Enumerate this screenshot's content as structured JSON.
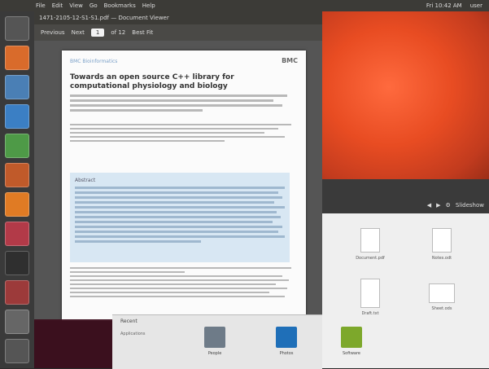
{
  "topbar": {
    "menu": [
      "File",
      "Edit",
      "View",
      "Go",
      "Bookmarks",
      "Help"
    ],
    "status": [
      "Fri 10:42 AM",
      "user"
    ]
  },
  "viewer": {
    "title": "1471-2105-12-S1-S1.pdf — Document Viewer",
    "toolbar": {
      "prev": "Previous",
      "next": "Next",
      "page_value": "1",
      "page_of": "of 12",
      "zoom": "Best Fit"
    }
  },
  "page": {
    "journal": "BMC Bioinformatics",
    "logo": "BMC",
    "title": "Towards an open source C++ library for computational physiology and biology",
    "abstract_heading": "Abstract"
  },
  "photo_viewer": {
    "controls": [
      "◀",
      "▶",
      "⚙",
      "Slideshow"
    ]
  },
  "files": [
    {
      "name": "Document.pdf",
      "kind": "doc"
    },
    {
      "name": "Notes.odt",
      "kind": "doc"
    },
    {
      "name": "Draft.txt",
      "kind": "doc"
    },
    {
      "name": "Sheet.ods",
      "kind": "doc"
    }
  ],
  "shelf": {
    "heading": "Recent",
    "sub": "Applications",
    "items": [
      {
        "name": "People",
        "color": "#6e7b88"
      },
      {
        "name": "Photos",
        "color": "#1f6fb8"
      },
      {
        "name": "Software",
        "color": "#7da82b"
      }
    ]
  }
}
